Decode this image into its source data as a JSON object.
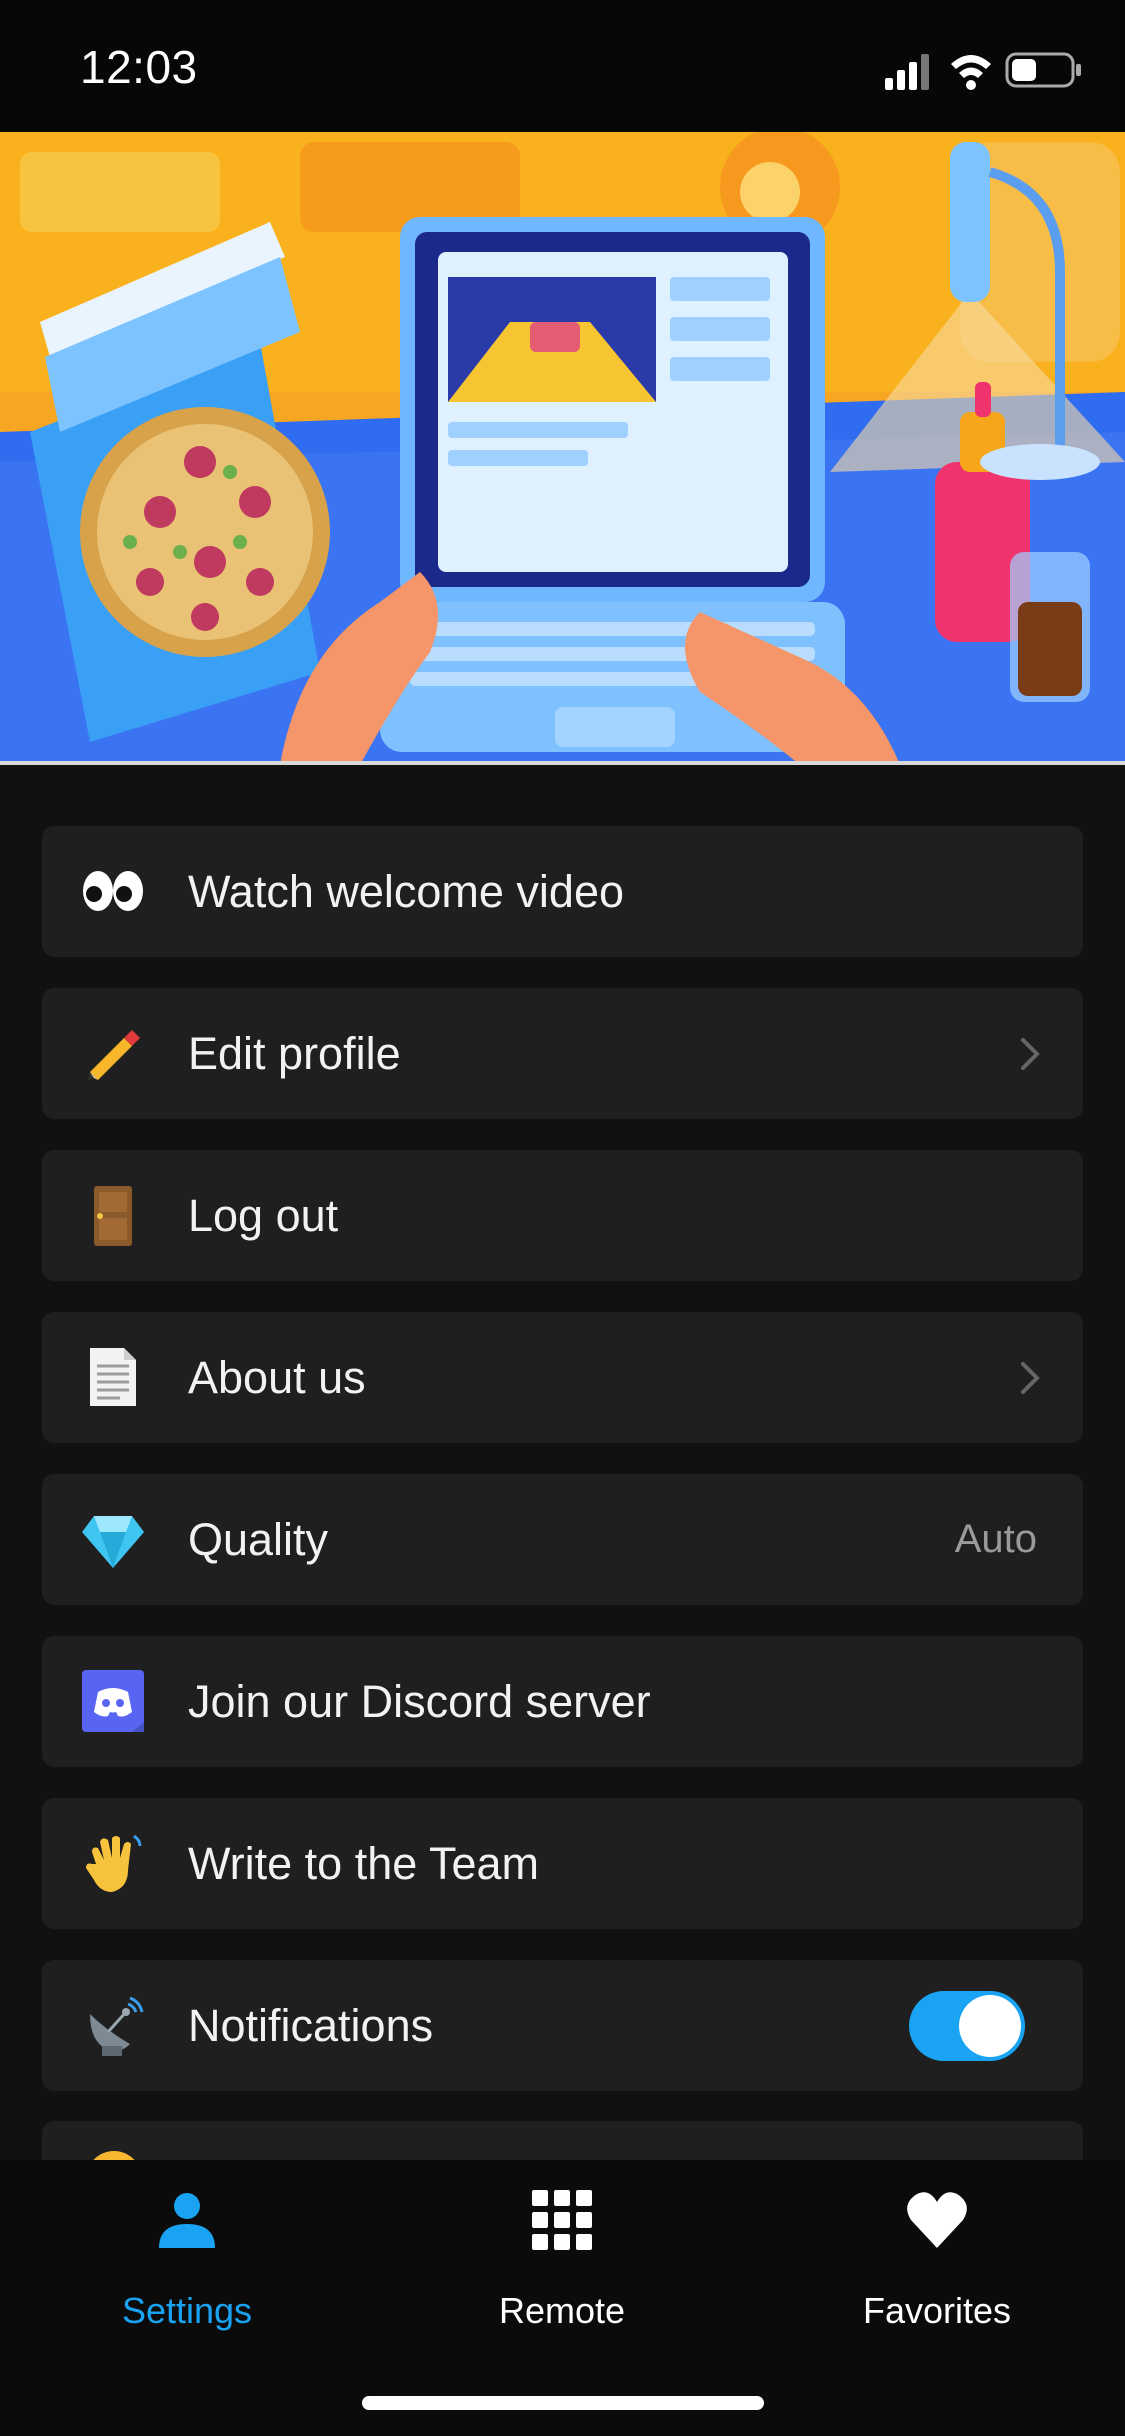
{
  "status_bar": {
    "time": "12:03"
  },
  "menu": {
    "items": [
      {
        "label": "Watch welcome video",
        "icon": "eyes-icon"
      },
      {
        "label": "Edit profile",
        "icon": "pencil-icon",
        "chevron": true
      },
      {
        "label": "Log out",
        "icon": "door-icon"
      },
      {
        "label": "About us",
        "icon": "document-icon",
        "chevron": true
      },
      {
        "label": "Quality",
        "icon": "gem-icon",
        "value": "Auto"
      },
      {
        "label": "Join our Discord server",
        "icon": "discord-icon"
      },
      {
        "label": "Write to the Team",
        "icon": "waving-hand-icon"
      },
      {
        "label": "Notifications",
        "icon": "satellite-antenna-icon",
        "toggle_on": true
      }
    ]
  },
  "tabbar": {
    "tabs": [
      {
        "label": "Settings",
        "icon": "person-icon",
        "active": true
      },
      {
        "label": "Remote",
        "icon": "grid-icon",
        "active": false
      },
      {
        "label": "Favorites",
        "icon": "heart-icon",
        "active": false
      }
    ]
  },
  "colors": {
    "accent": "#1aa3f2",
    "row_bg": "#1f1f1f",
    "background": "#111111"
  }
}
